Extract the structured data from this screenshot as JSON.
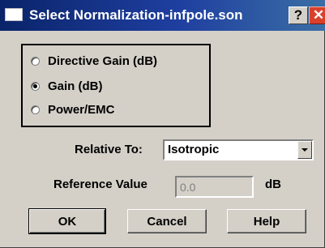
{
  "window": {
    "title": "Select Normalization-infpole.son",
    "help_glyph": "?",
    "close_glyph": "✕"
  },
  "options": [
    {
      "label": "Directive Gain (dB)",
      "checked": false
    },
    {
      "label": "Gain (dB)",
      "checked": true
    },
    {
      "label": "Power/EMC",
      "checked": false
    }
  ],
  "relative_to": {
    "label": "Relative To:",
    "selected": "Isotropic"
  },
  "reference": {
    "label": "Reference Value",
    "value": "0.0",
    "unit": "dB"
  },
  "buttons": {
    "ok": "OK",
    "cancel": "Cancel",
    "help": "Help"
  }
}
